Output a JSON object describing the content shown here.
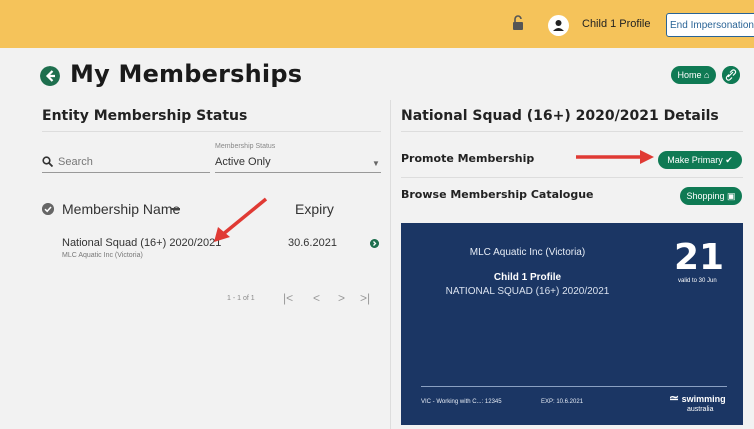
{
  "header": {
    "profile_name": "Child 1 Profile",
    "end_impersonation_label": "End Impersonation",
    "brand_color": "#f5c35a"
  },
  "page": {
    "title": "My Memberships",
    "home_label": "Home",
    "accent": "#0f7a54"
  },
  "left": {
    "heading": "Entity Membership Status",
    "search_label": "Search",
    "status_label": "Membership Status",
    "status_value": "Active Only",
    "col_name": "Membership Name",
    "col_expiry": "Expiry",
    "rows": [
      {
        "name": "National Squad (16+) 2020/2021",
        "org": "MLC Aquatic Inc (Victoria)",
        "expiry": "30.6.2021"
      }
    ],
    "pager_text": "1 - 1 of 1"
  },
  "right": {
    "heading": "National Squad (16+) 2020/2021 Details",
    "promote_label": "Promote Membership",
    "make_primary_label": "Make Primary",
    "browse_label": "Browse Membership Catalogue",
    "shopping_label": "Shopping"
  },
  "card": {
    "org": "MLC Aquatic Inc (Victoria)",
    "member_name": "Child 1 Profile",
    "squad": "NATIONAL SQUAD (16+) 2020/2021",
    "year": "21",
    "valid": "valid to 30 Jun",
    "foot_check": "VIC - Working with C...: 12345",
    "foot_exp": "EXP: 10.6.2021",
    "logo_line1": "swimming",
    "logo_line2": "australia",
    "bg": "#1b3664"
  }
}
